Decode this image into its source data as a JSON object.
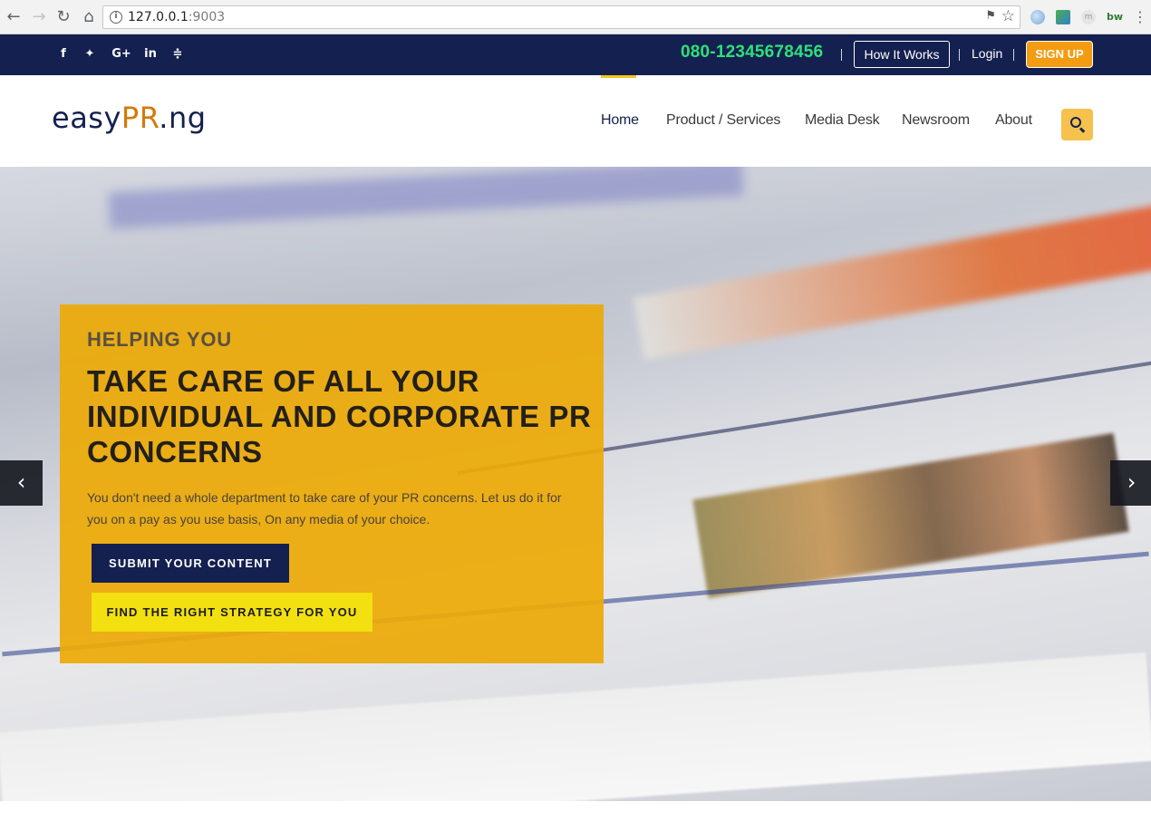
{
  "browser": {
    "back_icon": "arrow-left-icon",
    "forward_icon": "arrow-right-icon",
    "reload_icon": "reload-icon",
    "home_icon": "home-icon",
    "url_host": "127.0.0.1",
    "url_port": ":9003",
    "extensions": [
      "globe-extension",
      "photo-extension",
      "m-extension",
      "bw-extension"
    ],
    "ext_m_label": "m",
    "ext_bw_label": "bw"
  },
  "topbar": {
    "social_icons": [
      "facebook-icon",
      "twitter-icon",
      "google-plus-icon",
      "linkedin-icon",
      "rss-icon"
    ],
    "phone": "080-12345678456",
    "how_it_works": "How It Works",
    "login": "Login",
    "signup": "SIGN UP",
    "background_color": "#14204f",
    "phone_color": "#2ee07a",
    "signup_color": "#f39c12"
  },
  "nav": {
    "logo": {
      "part1": "easy",
      "part2": "PR",
      "part3": ".ng"
    },
    "items": [
      {
        "label": "Home",
        "active": true
      },
      {
        "label": "Product / Services",
        "active": false
      },
      {
        "label": "Media Desk",
        "active": false
      },
      {
        "label": "Newsroom",
        "active": false
      },
      {
        "label": "About",
        "active": false
      }
    ],
    "search_icon": "search-icon",
    "accent_color": "#f5c518"
  },
  "hero": {
    "kicker": "HELPING YOU",
    "heading": "TAKE CARE OF ALL YOUR INDIVIDUAL AND CORPORATE PR CONCERNS",
    "body": "You don't need a whole department to take care of your PR concerns. Let us do it for you on a pay as you use basis, On any media of your choice.",
    "primary_cta": "SUBMIT YOUR CONTENT",
    "secondary_cta": "FIND THE RIGHT STRATEGY FOR YOU",
    "prev_icon": "chevron-left-icon",
    "next_icon": "chevron-right-icon",
    "card_color": "#ecaa08"
  }
}
